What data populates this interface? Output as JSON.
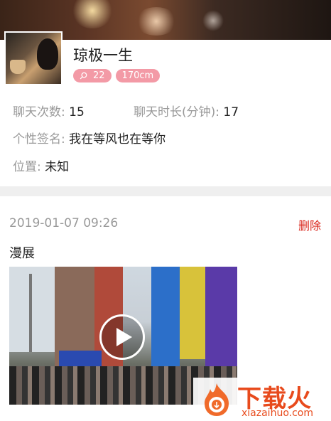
{
  "profile": {
    "name": "琼极一生",
    "badges": {
      "count": "22",
      "height": "170cm"
    },
    "stats": {
      "chat_count_label": "聊天次数: ",
      "chat_count_value": "15",
      "chat_duration_label": "聊天时长(分钟): ",
      "chat_duration_value": "17",
      "signature_label": "个性签名: ",
      "signature_value": "我在等风也在等你",
      "location_label": "位置: ",
      "location_value": "未知"
    }
  },
  "post": {
    "timestamp": "2019-01-07 09:26",
    "delete_label": "删除",
    "text": "漫展"
  },
  "watermark": {
    "title": "下载火",
    "url": "xiazaihuo.com"
  },
  "colors": {
    "badge_pink": "#f39aa6",
    "delete_red": "#d9261c",
    "watermark_orange": "#e84a1c"
  },
  "icons": {
    "badge_count": "search-icon",
    "video_play": "play-icon"
  }
}
